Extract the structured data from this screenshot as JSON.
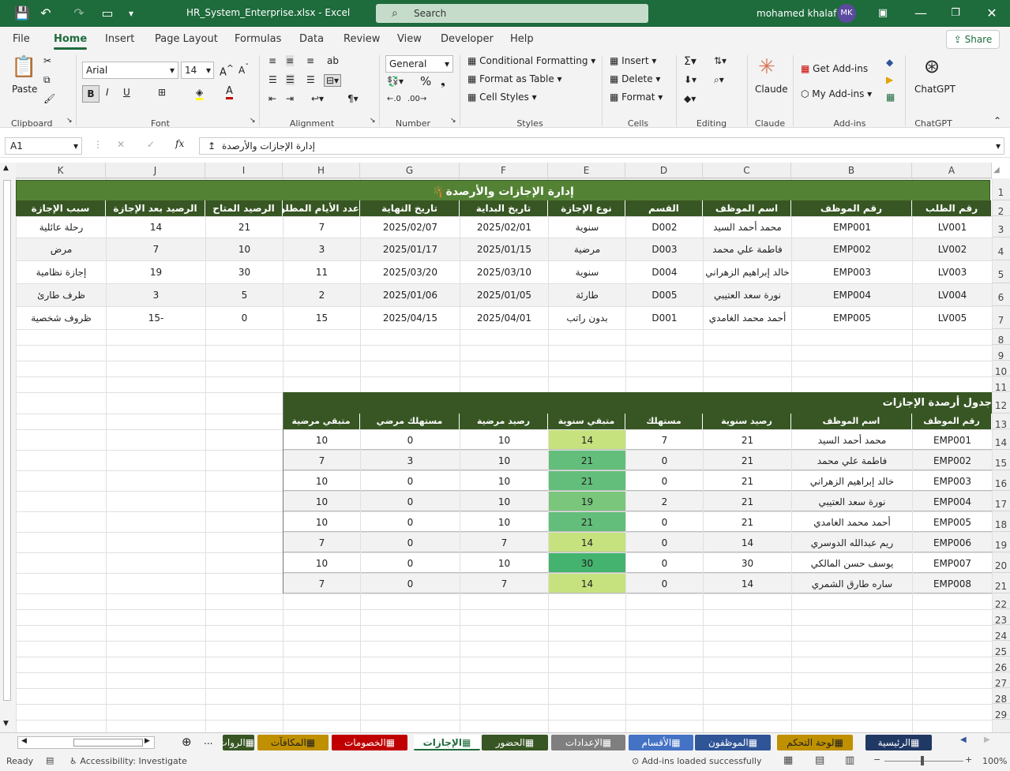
{
  "window": {
    "file_name": "HR_System_Enterprise.xlsx",
    "app": "Excel",
    "search_placeholder": "Search",
    "user": "mohamed khalaf",
    "user_initials": "MK"
  },
  "menu": [
    "File",
    "Home",
    "Insert",
    "Page Layout",
    "Formulas",
    "Data",
    "Review",
    "View",
    "Developer",
    "Help"
  ],
  "share_label": "Share",
  "ribbon": {
    "clipboard": {
      "paste": "Paste",
      "group": "Clipboard"
    },
    "font": {
      "name": "Arial",
      "size": "14",
      "bold": "B",
      "italic": "I",
      "underline": "U",
      "group": "Font"
    },
    "alignment": {
      "group": "Alignment"
    },
    "number": {
      "format": "General",
      "group": "Number",
      "percent": "%"
    },
    "styles": {
      "conditional": "Conditional Formatting",
      "table": "Format as Table",
      "cell": "Cell Styles",
      "group": "Styles"
    },
    "cells": {
      "insert": "Insert",
      "delete": "Delete",
      "format": "Format",
      "group": "Cells"
    },
    "editing": {
      "group": "Editing"
    },
    "claude": {
      "label": "Claude",
      "group": "Claude"
    },
    "addins": {
      "get": "Get Add-ins",
      "my": "My Add-ins",
      "group": "Add-ins"
    },
    "chatgpt": {
      "label": "ChatGPT",
      "group": "ChatGPT"
    }
  },
  "formula": {
    "cell": "A1",
    "content": "إدارة الإجازات والأرصدة"
  },
  "columns": [
    "A",
    "B",
    "C",
    "D",
    "E",
    "F",
    "G",
    "H",
    "I",
    "J",
    "K"
  ],
  "rows": [
    "1",
    "2",
    "3",
    "4",
    "5",
    "6",
    "7",
    "8",
    "9",
    "10",
    "11",
    "12",
    "13",
    "14",
    "15",
    "16",
    "17",
    "18",
    "19",
    "20",
    "21",
    "22",
    "23",
    "24",
    "25",
    "26",
    "27",
    "28",
    "29"
  ],
  "sheet_title": "إدارة الإجازات والأرصدة",
  "leave_headers": [
    "رقم الطلب",
    "رقم الموظف",
    "اسم الموظف",
    "القسم",
    "نوع الإجازة",
    "تاريخ البداية",
    "تاريخ النهاية",
    "عدد الأيام المطلوبة",
    "الرصيد المتاح",
    "الرصيد بعد الإجازة",
    "سبب الإجازة"
  ],
  "leave_rows": [
    [
      "LV001",
      "EMP001",
      "محمد أحمد السيد",
      "D002",
      "سنوية",
      "2025/02/01",
      "2025/02/07",
      "7",
      "21",
      "14",
      "رحلة عائلية"
    ],
    [
      "LV002",
      "EMP002",
      "فاطمة علي محمد",
      "D003",
      "مرضية",
      "2025/01/15",
      "2025/01/17",
      "3",
      "10",
      "7",
      "مرض"
    ],
    [
      "LV003",
      "EMP003",
      "خالد إبراهيم الزهراني",
      "D004",
      "سنوية",
      "2025/03/10",
      "2025/03/20",
      "11",
      "30",
      "19",
      "إجازة نظامية"
    ],
    [
      "LV004",
      "EMP004",
      "نورة سعد العتيبي",
      "D005",
      "طارئة",
      "2025/01/05",
      "2025/01/06",
      "2",
      "5",
      "3",
      "ظرف طارئ"
    ],
    [
      "LV005",
      "EMP005",
      "أحمد محمد الغامدي",
      "D001",
      "بدون راتب",
      "2025/04/01",
      "2025/04/15",
      "15",
      "0",
      "-15",
      "ظروف شخصية"
    ]
  ],
  "balance_title": "جدول أرصدة الإجازات",
  "balance_headers": [
    "رقم الموظف",
    "اسم الموظف",
    "رصيد سنوية",
    "مستهلك",
    "متبقي سنوية",
    "رصيد مرضية",
    "مستهلك مرضي",
    "متبقي مرضية"
  ],
  "balance_rows": [
    [
      "EMP001",
      "محمد أحمد السيد",
      "21",
      "7",
      "14",
      "10",
      "0",
      "10"
    ],
    [
      "EMP002",
      "فاطمة علي محمد",
      "21",
      "0",
      "21",
      "10",
      "3",
      "7"
    ],
    [
      "EMP003",
      "خالد إبراهيم الزهراني",
      "21",
      "0",
      "21",
      "10",
      "0",
      "10"
    ],
    [
      "EMP004",
      "نورة سعد العتيبي",
      "21",
      "2",
      "19",
      "10",
      "0",
      "10"
    ],
    [
      "EMP005",
      "أحمد محمد الغامدي",
      "21",
      "0",
      "21",
      "10",
      "0",
      "10"
    ],
    [
      "EMP006",
      "ريم عبدالله الدوسري",
      "14",
      "0",
      "14",
      "7",
      "0",
      "7"
    ],
    [
      "EMP007",
      "يوسف حسن المالكي",
      "30",
      "0",
      "30",
      "10",
      "0",
      "10"
    ],
    [
      "EMP008",
      "ساره طارق الشمري",
      "14",
      "0",
      "14",
      "7",
      "0",
      "7"
    ]
  ],
  "remaining_colors": {
    "14": "#c6e27e",
    "21": "#63be7b",
    "19": "#79c67c",
    "30": "#44b36f"
  },
  "tabs": [
    {
      "label": "الرئيسية",
      "color": "#203864"
    },
    {
      "label": "لوحة التحكم",
      "color": "#bf9000"
    },
    {
      "label": "الموظفون",
      "color": "#2f5597"
    },
    {
      "label": "الأقسام",
      "color": "#4472c4"
    },
    {
      "label": "الإعدادات",
      "color": "#7f7f7f"
    },
    {
      "label": "الحضور",
      "color": "#375623"
    },
    {
      "label": "الإجازات",
      "color": "#ffffff"
    },
    {
      "label": "الخصومات",
      "color": "#c00000"
    },
    {
      "label": "المكافآت",
      "color": "#bf9000"
    },
    {
      "label": "الروات",
      "color": "#375623"
    }
  ],
  "status": {
    "ready": "Ready",
    "accessibility": "Accessibility: Investigate",
    "addins": "Add-ins loaded successfully",
    "zoom": "100%",
    "more_tabs": "..."
  }
}
